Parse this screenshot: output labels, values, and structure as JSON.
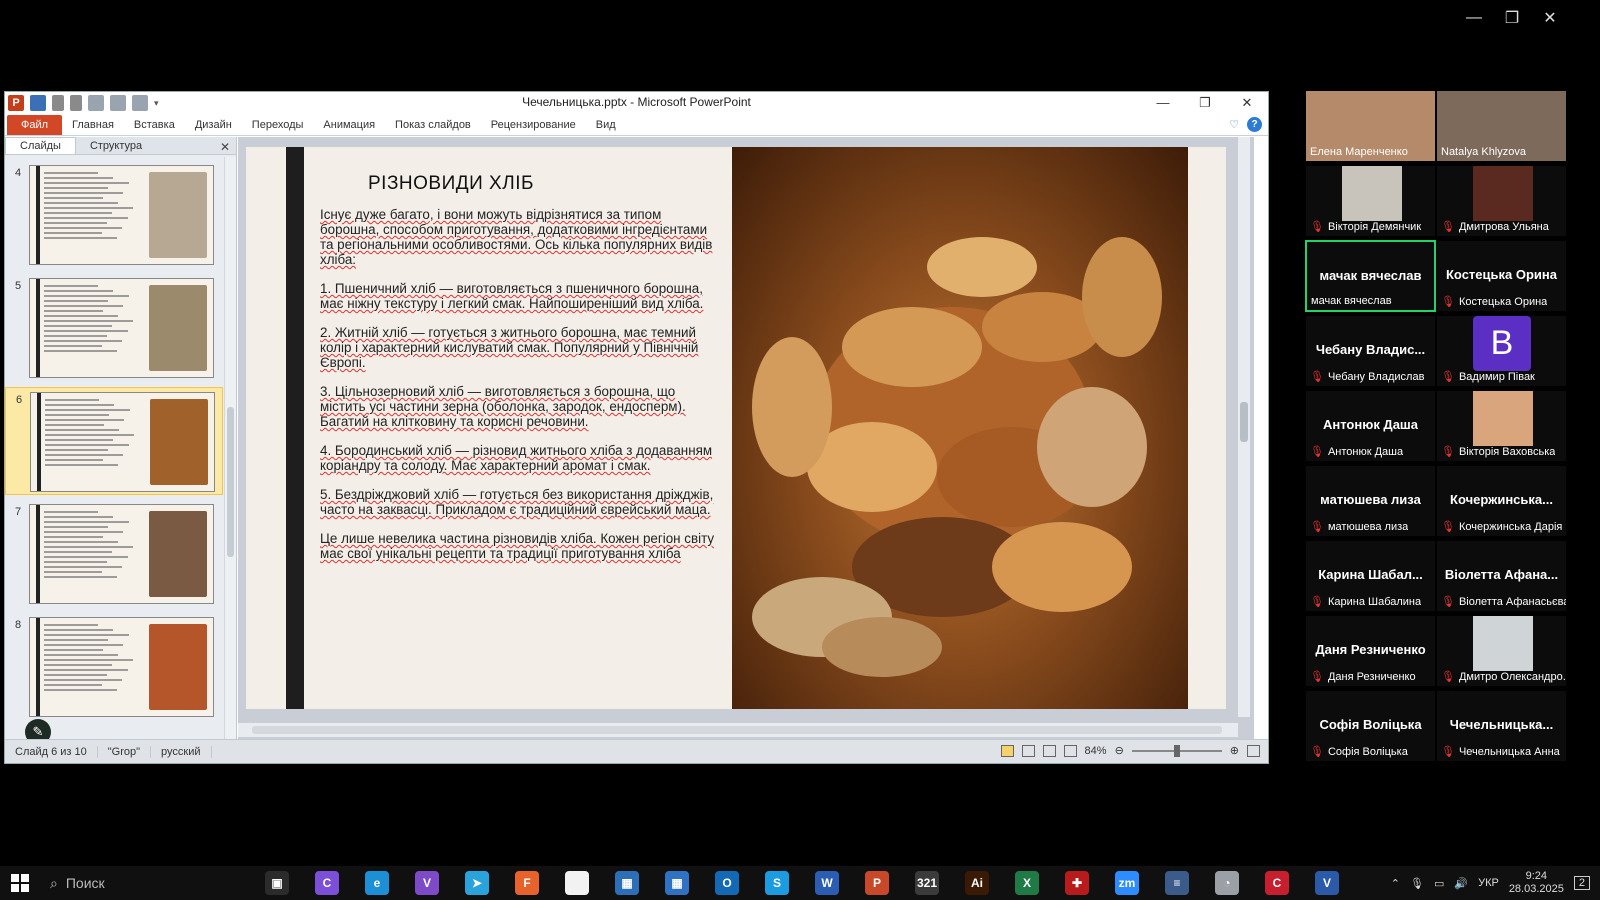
{
  "window": {
    "title": "Чечельницька.pptx  -  Microsoft PowerPoint",
    "minimize": "—",
    "restore": "❐",
    "close": "✕"
  },
  "zoom_window": {
    "minimize": "—",
    "restore": "❐",
    "close": "✕"
  },
  "ribbon": {
    "file": "Файл",
    "tabs": [
      "Главная",
      "Вставка",
      "Дизайн",
      "Переходы",
      "Анимация",
      "Показ слайдов",
      "Рецензирование",
      "Вид"
    ],
    "help": "?"
  },
  "panel": {
    "tabs": [
      "Слайды",
      "Структура"
    ],
    "close": "✕",
    "thumbs": [
      {
        "num": "4",
        "img_color": "#b7a893"
      },
      {
        "num": "5",
        "img_color": "#9c8a6d"
      },
      {
        "num": "6",
        "img_color": "#a0612a",
        "selected": true
      },
      {
        "num": "7",
        "img_color": "#7a5a43"
      },
      {
        "num": "8",
        "img_color": "#b5562a"
      }
    ]
  },
  "slide": {
    "title": "РІЗНОВИДИ ХЛІБ",
    "paragraphs": [
      "Існує дуже багато, і вони можуть відрізнятися за типом борошна, способом приготування, додатковими інгредієнтами та регіональними особливостями. Ось кілька популярних видів хліба:",
      "1. Пшеничний хліб — виготовляється з пшеничного борошна, має ніжну текстуру і легкий смак. Найпоширеніший вид хліба.",
      "2. Житній хліб — готується з житнього борошна, має темний колір і характерний кислуватий смак. Популярний у Північній Європі.",
      "3. Цільнозерновий хліб — виготовляється з борошна, що містить усі частини зерна (оболонка, зародок, ендосперм). Багатий на клітковину та корисні речовини.",
      "4. Бородинський хліб — різновид житнього хліба з додаванням коріандру та солоду. Має характерний аромат і смак.",
      "5. Бездріжджовий хліб — готується без використання дріжджів, часто на заквасці. Прикладом є традиційний єврейський маца.",
      "Це лише невелика частина різновидів хліба. Кожен регіон світу має свої унікальні рецепти та традиції приготування хліба"
    ]
  },
  "status": {
    "slide_of": "Слайд 6 из 10",
    "theme": "\"Grop\"",
    "language": "русский",
    "zoom": "84%"
  },
  "participants": [
    {
      "name": "Елена Маренченко",
      "video": true,
      "color": "#b58a6a",
      "muted": false
    },
    {
      "name": "Natalya Khlyzova",
      "video": true,
      "color": "#7d6a5a",
      "muted": false
    },
    {
      "name": "Вікторія Демянчик",
      "video": true,
      "color": "#c9c4bb",
      "muted": true
    },
    {
      "name": "Дмитрова Ульяна",
      "video": true,
      "color": "#5a2a20",
      "muted": true
    },
    {
      "name": "мачак вячеслав",
      "center": "мачак вячеслав",
      "active": true,
      "muted": false
    },
    {
      "name": "Костецька Орина",
      "center": "Костецька Орина",
      "muted": true
    },
    {
      "name": "Чебану Владислав",
      "center": "Чебану Владис...",
      "muted": true
    },
    {
      "name": "Вадимир Півак",
      "avatar": "B",
      "muted": true
    },
    {
      "name": "Антонюк Даша",
      "center": "Антонюк Даша",
      "muted": true
    },
    {
      "name": "Вікторія Ваховська",
      "video": true,
      "color": "#d8a57c",
      "muted": true
    },
    {
      "name": "матюшева лиза",
      "center": "матюшева лиза",
      "muted": true
    },
    {
      "name": "Кочержинська Дарія",
      "center": "Кочержинська...",
      "muted": true
    },
    {
      "name": "Карина Шабалина",
      "center": "Карина Шабал...",
      "muted": true
    },
    {
      "name": "Віолетта Афанасьєва",
      "center": "Віолетта Афана...",
      "muted": true
    },
    {
      "name": "Даня Резниченко",
      "center": "Даня Резниченко",
      "muted": true
    },
    {
      "name": "Дмитро Олександро...",
      "video": true,
      "color": "#cfd4d6",
      "muted": true
    },
    {
      "name": "Софія Воліцька",
      "center": "Софія Воліцька",
      "muted": true
    },
    {
      "name": "Чечельницька Анна",
      "center": "Чечельницька...",
      "muted": true
    }
  ],
  "taskbar": {
    "search": "Поиск",
    "apps": [
      {
        "name": "task-view",
        "label": "▣",
        "color": "#2b2b2b"
      },
      {
        "name": "copilot",
        "label": "C",
        "color": "#7b4fd8"
      },
      {
        "name": "edge",
        "label": "e",
        "color": "#1d8fd6"
      },
      {
        "name": "viber",
        "label": "V",
        "color": "#7d4bc8"
      },
      {
        "name": "telegram",
        "label": "➤",
        "color": "#2aa3dd"
      },
      {
        "name": "firefox",
        "label": "F",
        "color": "#e8622b"
      },
      {
        "name": "file",
        "label": "",
        "color": "#f2f2f2"
      },
      {
        "name": "calculator",
        "label": "▦",
        "color": "#2c6eb8"
      },
      {
        "name": "calendar",
        "label": "▦",
        "color": "#2f72c4"
      },
      {
        "name": "outlook",
        "label": "O",
        "color": "#1469b6"
      },
      {
        "name": "skype",
        "label": "S",
        "color": "#1c9be0"
      },
      {
        "name": "word",
        "label": "W",
        "color": "#2b5db3"
      },
      {
        "name": "powerpoint",
        "label": "P",
        "color": "#c8482a"
      },
      {
        "name": "calendar-321",
        "label": "321",
        "color": "#3b3b3b"
      },
      {
        "name": "illustrator",
        "label": "Ai",
        "color": "#3a1a05"
      },
      {
        "name": "excel",
        "label": "X",
        "color": "#1f7a45"
      },
      {
        "name": "puzzle",
        "label": "✚",
        "color": "#b81b1b"
      },
      {
        "name": "zoom",
        "label": "zm",
        "color": "#2d8cff"
      },
      {
        "name": "app-stack",
        "label": "≡",
        "color": "#3b5b8a"
      },
      {
        "name": "app-brain",
        "label": "◔",
        "color": "#9aa0a6"
      },
      {
        "name": "app-c",
        "label": "C",
        "color": "#c71f2d"
      },
      {
        "name": "visio",
        "label": "V",
        "color": "#2a5aa8"
      }
    ],
    "lang": "УКР",
    "time": "9:24",
    "date": "28.03.2025",
    "notifications": "2"
  }
}
